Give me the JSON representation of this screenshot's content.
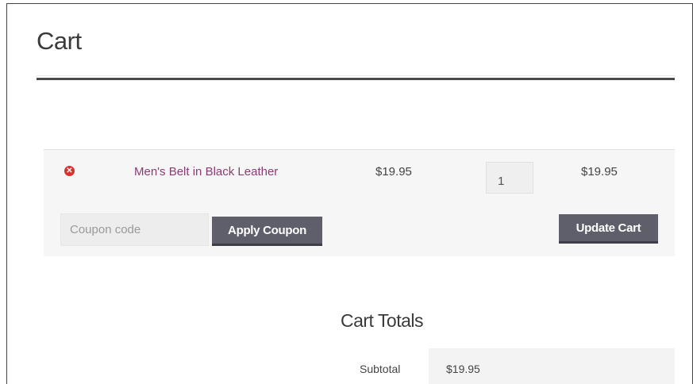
{
  "page": {
    "title": "Cart"
  },
  "cart": {
    "items": [
      {
        "remove_symbol": "✕",
        "product_name": "Men's Belt in Black Leather",
        "price": "$19.95",
        "quantity": "1",
        "total": "$19.95"
      }
    ],
    "coupon": {
      "placeholder": "Coupon code",
      "value": "",
      "apply_label": "Apply Coupon"
    },
    "update_label": "Update Cart"
  },
  "totals": {
    "title": "Cart Totals",
    "subtotal_label": "Subtotal",
    "subtotal_value": "$19.95"
  },
  "icons": {
    "remove": "remove-item-icon"
  },
  "colors": {
    "product_link": "#8a3c74",
    "button_bg": "#5f5f6b",
    "remove_icon": "#d9322e",
    "row_bg": "#f6f6f6"
  }
}
